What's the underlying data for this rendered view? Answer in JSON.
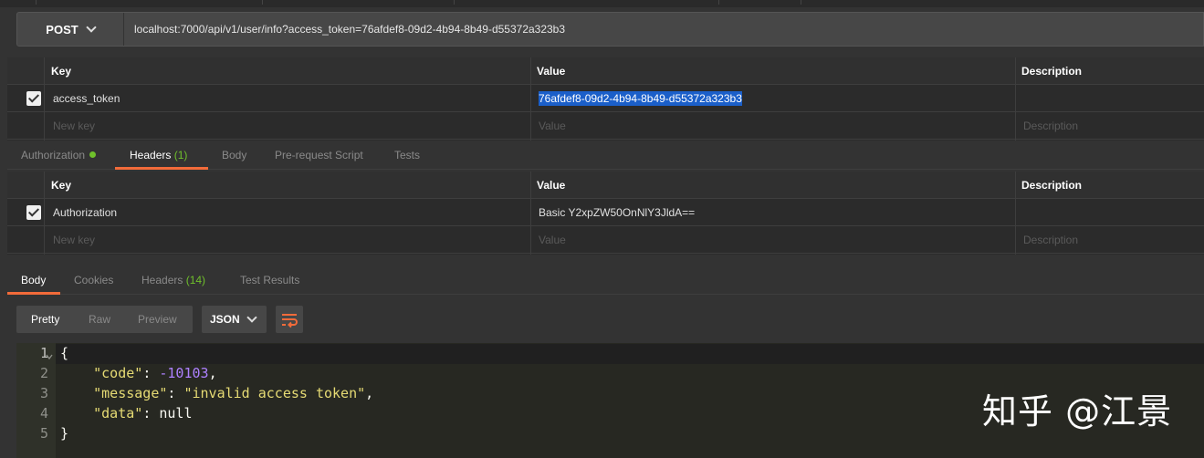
{
  "request": {
    "method": "POST",
    "url": "localhost:7000/api/v1/user/info?access_token=76afdef8-09d2-4b94-8b49-d55372a323b3"
  },
  "params_table": {
    "headers": {
      "key": "Key",
      "value": "Value",
      "description": "Description"
    },
    "rows": [
      {
        "checked": true,
        "key": "access_token",
        "value": "76afdef8-09d2-4b94-8b49-d55372a323b3",
        "description": ""
      }
    ],
    "placeholder": {
      "key": "New key",
      "value": "Value",
      "description": "Description"
    }
  },
  "request_tabs": [
    {
      "label": "Authorization",
      "indicator": "green-dot"
    },
    {
      "label": "Headers",
      "count": "(1)",
      "active": true
    },
    {
      "label": "Body"
    },
    {
      "label": "Pre-request Script"
    },
    {
      "label": "Tests"
    }
  ],
  "headers_table": {
    "headers": {
      "key": "Key",
      "value": "Value",
      "description": "Description"
    },
    "rows": [
      {
        "checked": true,
        "key": "Authorization",
        "value": "Basic Y2xpZW50OnNlY3JldA==",
        "description": ""
      }
    ],
    "placeholder": {
      "key": "New key",
      "value": "Value",
      "description": "Description"
    }
  },
  "response_tabs": [
    {
      "label": "Body",
      "active": true
    },
    {
      "label": "Cookies"
    },
    {
      "label": "Headers",
      "count": "(14)"
    },
    {
      "label": "Test Results"
    }
  ],
  "view_modes": [
    "Pretty",
    "Raw",
    "Preview"
  ],
  "active_view": "Pretty",
  "format": "JSON",
  "wrap_icon": "wrap-lines-icon",
  "response_body": {
    "line_numbers": [
      "1",
      "2",
      "3",
      "4",
      "5"
    ],
    "lines": {
      "open": "{",
      "code_key": "\"code\"",
      "code_value": "-10103",
      "message_key": "\"message\"",
      "message_value": "\"invalid access token\"",
      "data_key": "\"data\"",
      "data_value": "null",
      "close": "}"
    }
  },
  "watermark": "知乎 @江景",
  "colors": {
    "accent": "#f26b3a",
    "status_green": "#6fc02b",
    "selection": "#1b5fc9"
  }
}
